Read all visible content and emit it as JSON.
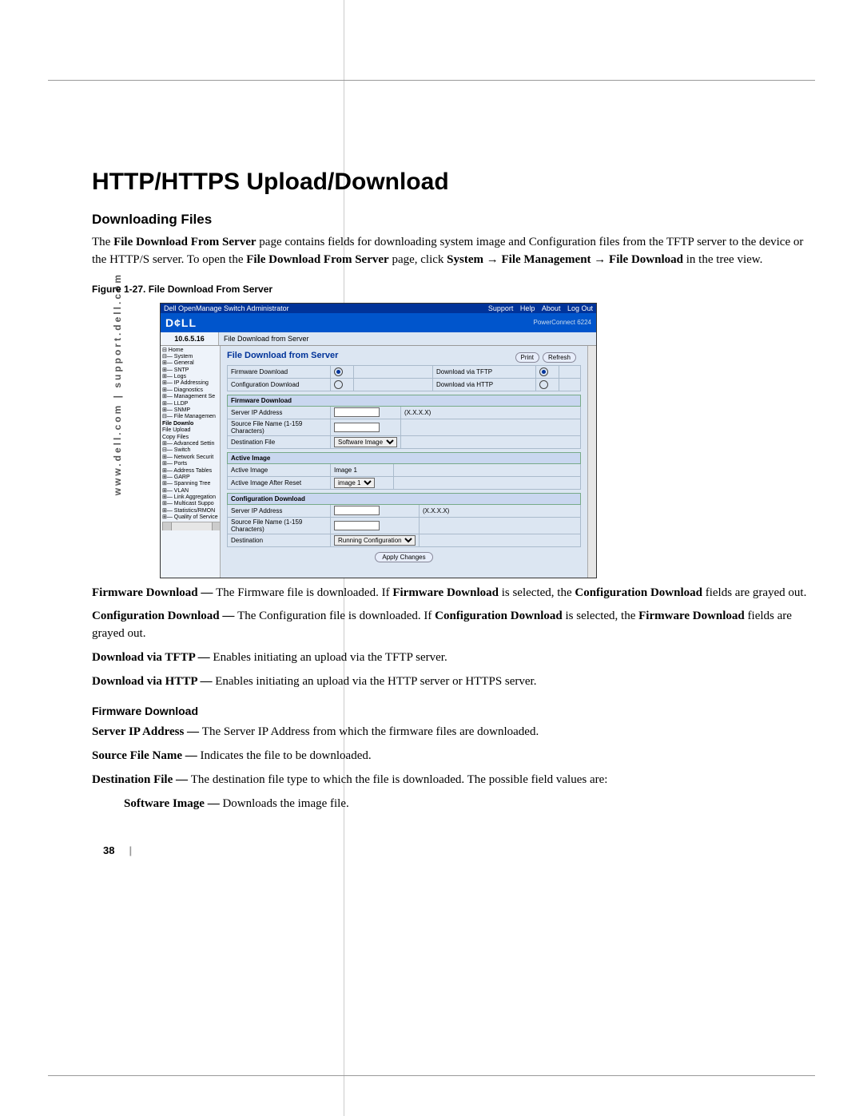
{
  "sidetext": "www.dell.com | support.dell.com",
  "h1": "HTTP/HTTPS Upload/Download",
  "h2": "Downloading Files",
  "intro": {
    "t1": "The ",
    "b1": "File Download From Server",
    "t2": " page contains fields for downloading system image and Configuration files from the TFTP server to the device or the HTTP/S server. To open the ",
    "b2": "File Download From Server",
    "t3": " page, click ",
    "b3": "System",
    "arrow1": " → ",
    "b4": "File Management",
    "arrow2": " → ",
    "b5": "File Download",
    "t4": " in the tree view."
  },
  "figcap": "Figure 1-27.    File Download From Server",
  "shot": {
    "titlebar": "Dell OpenManage Switch Administrator",
    "links": {
      "support": "Support",
      "help": "Help",
      "about": "About",
      "logout": "Log Out"
    },
    "brand": "D¢LL",
    "model": "PowerConnect 6224",
    "ip": "10.6.5.16",
    "bc": "File Download from Server",
    "tree": [
      "⊟ Home",
      " ⊟— System",
      "  ⊞— General",
      "  ⊞— SNTP",
      "  ⊞— Logs",
      "  ⊞— IP Addressing",
      "  ⊞— Diagnostics",
      "  ⊞— Management Se",
      "  ⊞— LLDP",
      "  ⊞— SNMP",
      "  ⊟— File Managemen",
      "       File Downlo",
      "       File Upload",
      "       Copy Files",
      "  ⊞— Advanced Settin",
      " ⊟— Switch",
      "  ⊞— Network Securit",
      "  ⊞— Ports",
      "  ⊞— Address Tables",
      "  ⊞— GARP",
      "  ⊞— Spanning Tree",
      "  ⊞— VLAN",
      "  ⊞— Link Aggregation",
      "  ⊞— Multicast Suppo",
      " ⊞— Statistics/RMON",
      " ⊞— Quality of Service"
    ],
    "main": {
      "title": "File Download from Server",
      "print": "Print",
      "refresh": "Refresh",
      "t1": {
        "r1c1": "Firmware Download",
        "r1c3": "Download via TFTP",
        "r2c1": "Configuration Download",
        "r2c3": "Download via HTTP"
      },
      "t2": {
        "hdr": "Firmware Download",
        "r1": "Server IP Address",
        "r1hint": "(X.X.X.X)",
        "r2": "Source File Name (1-159 Characters)",
        "r3": "Destination File",
        "r3val": "Software Image"
      },
      "t3": {
        "hdr": "Active Image",
        "r1": "Active Image",
        "r1val": "Image 1",
        "r2": "Active Image After Reset",
        "r2val": "image 1"
      },
      "t4": {
        "hdr": "Configuration Download",
        "r1": "Server IP Address",
        "r1hint": "(X.X.X.X)",
        "r2": "Source File Name (1-159 Characters)",
        "r3": "Destination",
        "r3val": "Running Configuration"
      },
      "apply": "Apply Changes"
    }
  },
  "body": {
    "fw": {
      "b": "Firmware Download — ",
      "t1": "The Firmware file is downloaded. If ",
      "b2": "Firmware Download",
      "t2": " is selected, the ",
      "b3": "Configuration Download",
      "t3": " fields are grayed out."
    },
    "cd": {
      "b": "Configuration Download — ",
      "t1": "The Configuration file is downloaded. If ",
      "b2": "Configuration Download",
      "t2": " is selected, the ",
      "b3": "Firmware Download",
      "t3": " fields are grayed out."
    },
    "tftp": {
      "b": "Download via TFTP — ",
      "t": "Enables initiating an upload via the TFTP server."
    },
    "http": {
      "b": "Download via HTTP — ",
      "t": "Enables initiating an upload via the HTTP server or HTTPS server."
    }
  },
  "h3": "Firmware Download",
  "fd": {
    "sip": {
      "b": "Server IP Address — ",
      "t": "The Server IP Address from which the firmware files are downloaded."
    },
    "sfn": {
      "b": "Source File Name — ",
      "t": "Indicates the file to be downloaded."
    },
    "df": {
      "b": "Destination File — ",
      "t": "The destination file type to which the file is downloaded. The possible field values are:"
    },
    "si": {
      "b": "Software Image — ",
      "t": "Downloads the image file."
    }
  },
  "pagenum": "38"
}
